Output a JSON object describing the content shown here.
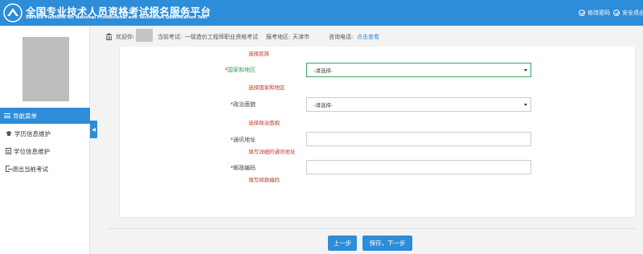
{
  "header": {
    "title_cn": "全国专业技术人员资格考试报名服务平台",
    "title_en": "Service Platform for National Professional and Technician Qualification Test",
    "change_password": "修改密码",
    "safe_exit": "安全退出"
  },
  "sidebar": {
    "nav_title": "导航菜单",
    "items": [
      {
        "label": "学历信息维护",
        "icon": "graduation-cap-icon"
      },
      {
        "label": "学位信息维护",
        "icon": "document-icon"
      },
      {
        "label": "退出当前考试",
        "icon": "sign-out-icon"
      }
    ],
    "toggle_glyph": "◀"
  },
  "infobar": {
    "welcome": "欢迎你:",
    "current_exam_label": "当前考试:",
    "current_exam": "一级造价工程师职业资格考试",
    "region_label": "报考地区:",
    "region": "天津市",
    "phone_label": "咨询电话:",
    "phone_link": "点击查看"
  },
  "form": {
    "ethnicity_hint": "选择民族",
    "country_label": "国家和地区",
    "country_value": "-请选择-",
    "country_hint": "选择国家和地区",
    "political_label": "政治面貌",
    "political_value": "-请选择-",
    "political_hint": "选择政治面貌",
    "address_label": "通讯地址",
    "address_value": "",
    "address_hint": "填写详细的通讯地址",
    "postal_label": "邮政编码",
    "postal_value": "",
    "postal_hint": "填写邮政编码",
    "required_mark": "*"
  },
  "buttons": {
    "prev": "上一步",
    "next": "保存，下一步"
  },
  "colors": {
    "primary": "#2d8dd8",
    "error": "#c0392b",
    "focus_green": "#32a866"
  }
}
